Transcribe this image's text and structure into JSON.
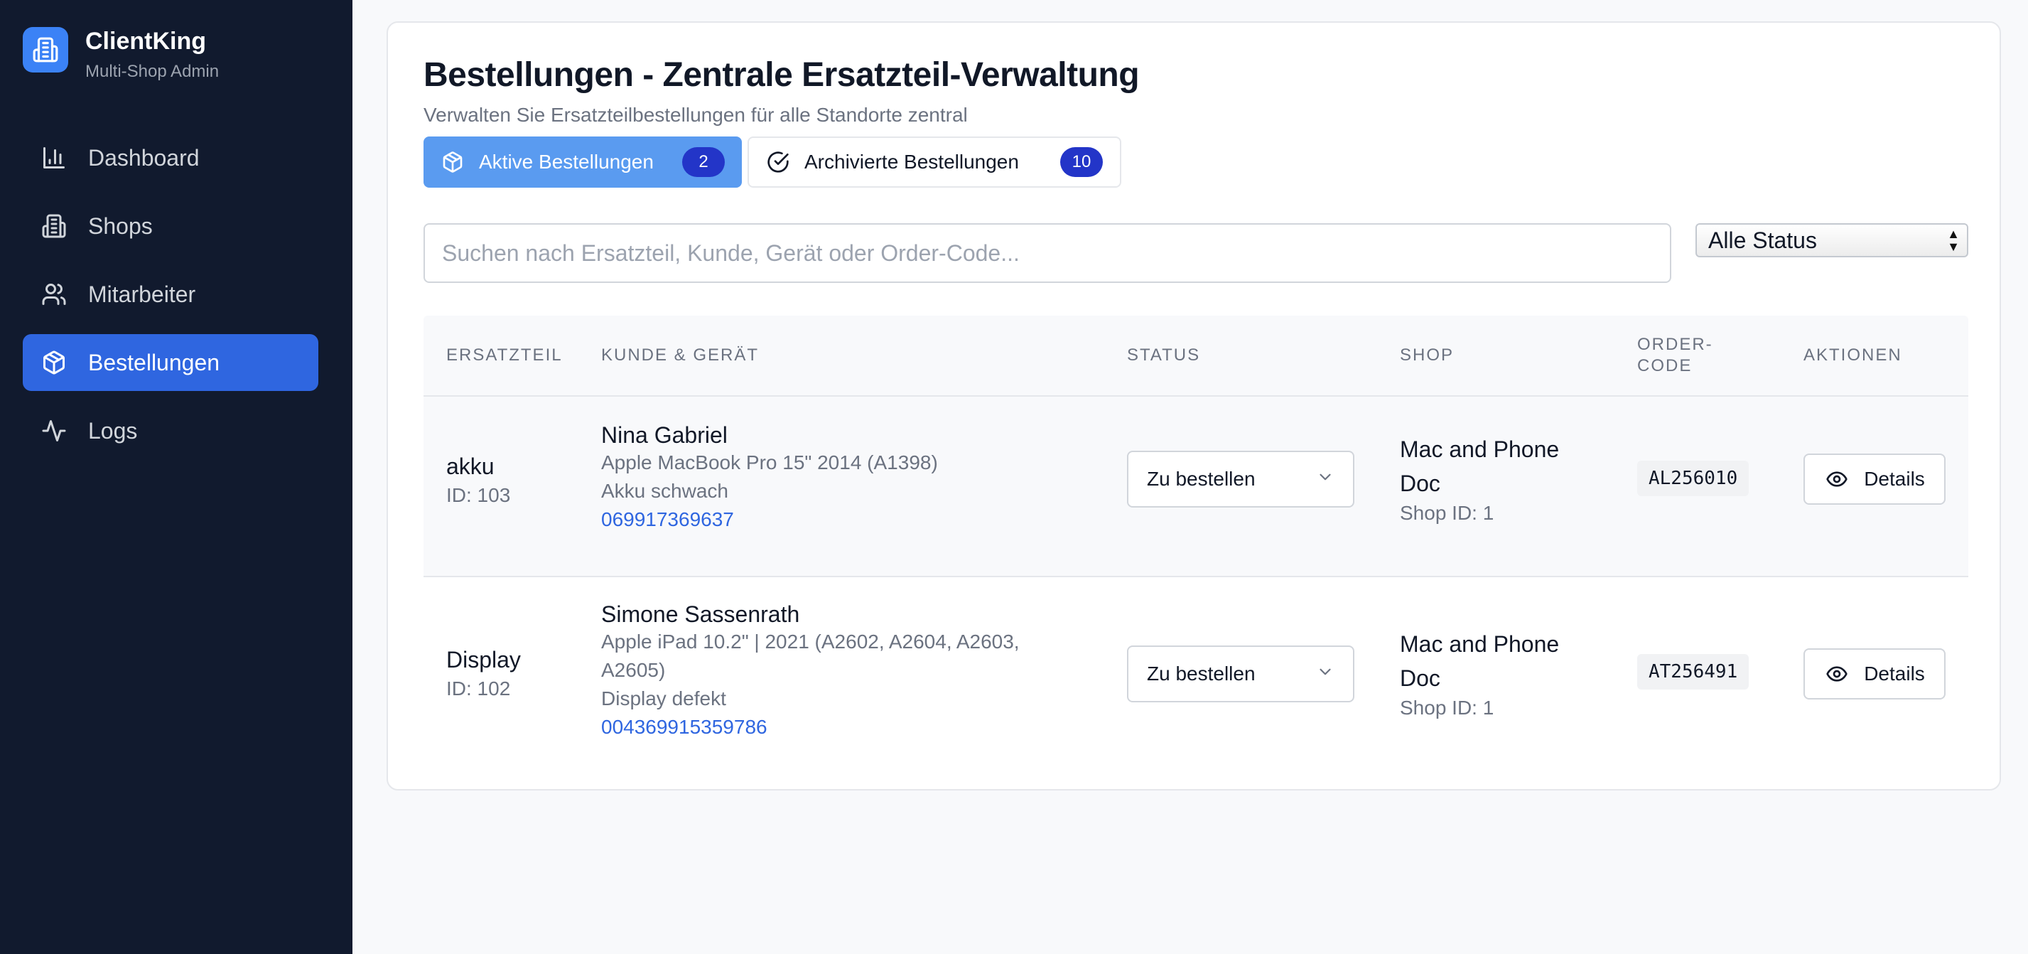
{
  "app": {
    "title": "ClientKing",
    "subtitle": "Multi-Shop Admin"
  },
  "sidebar": {
    "items": [
      {
        "label": "Dashboard",
        "icon": "bar-chart-icon"
      },
      {
        "label": "Shops",
        "icon": "building-icon"
      },
      {
        "label": "Mitarbeiter",
        "icon": "users-icon"
      },
      {
        "label": "Bestellungen",
        "icon": "package-icon",
        "active": true
      },
      {
        "label": "Logs",
        "icon": "activity-icon"
      }
    ]
  },
  "page": {
    "title": "Bestellungen - Zentrale Ersatzteil-Verwaltung",
    "subtitle": "Verwalten Sie Ersatzteilbestellungen für alle Standorte zentral"
  },
  "tabs": [
    {
      "label": "Aktive Bestellungen",
      "count": "2",
      "icon": "package-icon",
      "active": true
    },
    {
      "label": "Archivierte Bestellungen",
      "count": "10",
      "icon": "check-circle-icon",
      "active": false
    }
  ],
  "search": {
    "placeholder": "Suchen nach Ersatzteil, Kunde, Gerät oder Order-Code...",
    "value": ""
  },
  "filter": {
    "selected": "Alle Status"
  },
  "table": {
    "headers": [
      "ERSATZTEIL",
      "KUNDE & GERÄT",
      "STATUS",
      "SHOP",
      "ORDER-CODE",
      "AKTIONEN"
    ],
    "rows": [
      {
        "part": "akku",
        "part_id": "ID: 103",
        "customer": "Nina Gabriel",
        "device": "Apple MacBook Pro 15\" 2014 (A1398)",
        "issue": "Akku schwach",
        "phone": "069917369637",
        "status": "Zu bestellen",
        "shop": "Mac and Phone Doc",
        "shop_id": "Shop ID: 1",
        "order_code": "AL256010",
        "action": "Details"
      },
      {
        "part": "Display",
        "part_id": "ID: 102",
        "customer": "Simone Sassenrath",
        "device": "Apple iPad 10.2\" | 2021 (A2602, A2604, A2603, A2605)",
        "issue": "Display defekt",
        "phone": "004369915359786",
        "status": "Zu bestellen",
        "shop": "Mac and Phone Doc",
        "shop_id": "Shop ID: 1",
        "order_code": "AT256491",
        "action": "Details"
      }
    ]
  },
  "colors": {
    "sidebar_bg": "#111a2e",
    "accent": "#2f66e0",
    "tab_active": "#5a9bf0",
    "badge": "#2335c8"
  }
}
